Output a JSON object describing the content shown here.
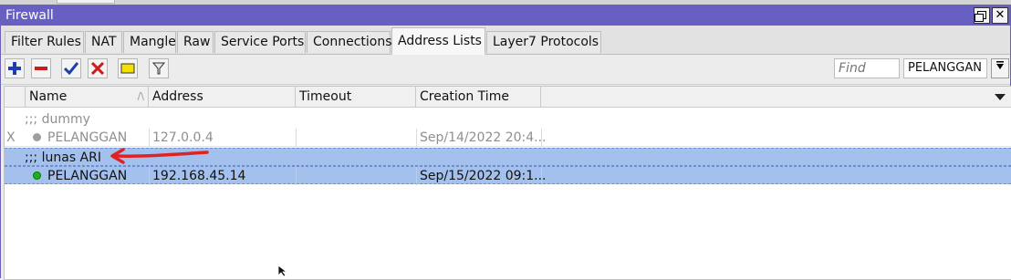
{
  "window": {
    "title": "Firewall"
  },
  "tabs": [
    {
      "label": "Filter Rules"
    },
    {
      "label": "NAT"
    },
    {
      "label": "Mangle"
    },
    {
      "label": "Raw"
    },
    {
      "label": "Service Ports"
    },
    {
      "label": "Connections"
    },
    {
      "label": "Address Lists",
      "active": true
    },
    {
      "label": "Layer7 Protocols"
    }
  ],
  "toolbar": {
    "buttons": [
      "add-icon",
      "remove-icon",
      "enable-icon",
      "disable-icon",
      "comment-icon",
      "filter-icon"
    ],
    "find_placeholder": "Find",
    "filter_value": "PELANGGAN"
  },
  "table": {
    "columns": [
      "Name",
      "Address",
      "Timeout",
      "Creation Time"
    ],
    "rows": [
      {
        "type": "comment",
        "text": ";;; dummy",
        "disabled": true
      },
      {
        "type": "entry",
        "flag": "X",
        "name": "PELANGGAN",
        "address": "127.0.0.4",
        "timeout": "",
        "creation_time": "Sep/14/2022 20:4...",
        "disabled": true
      },
      {
        "type": "comment",
        "text": ";;; lunas ARI",
        "selected": true
      },
      {
        "type": "entry",
        "flag": "",
        "name": "PELANGGAN",
        "address": "192.168.45.14",
        "timeout": "",
        "creation_time": "Sep/15/2022 09:1...",
        "selected": true
      }
    ]
  },
  "colors": {
    "titlebar": "#675fc2",
    "selection": "#a3c1ec",
    "annotation_arrow": "#e02222",
    "status_enabled": "#1fae1f",
    "status_disabled": "#9e9e9e"
  }
}
